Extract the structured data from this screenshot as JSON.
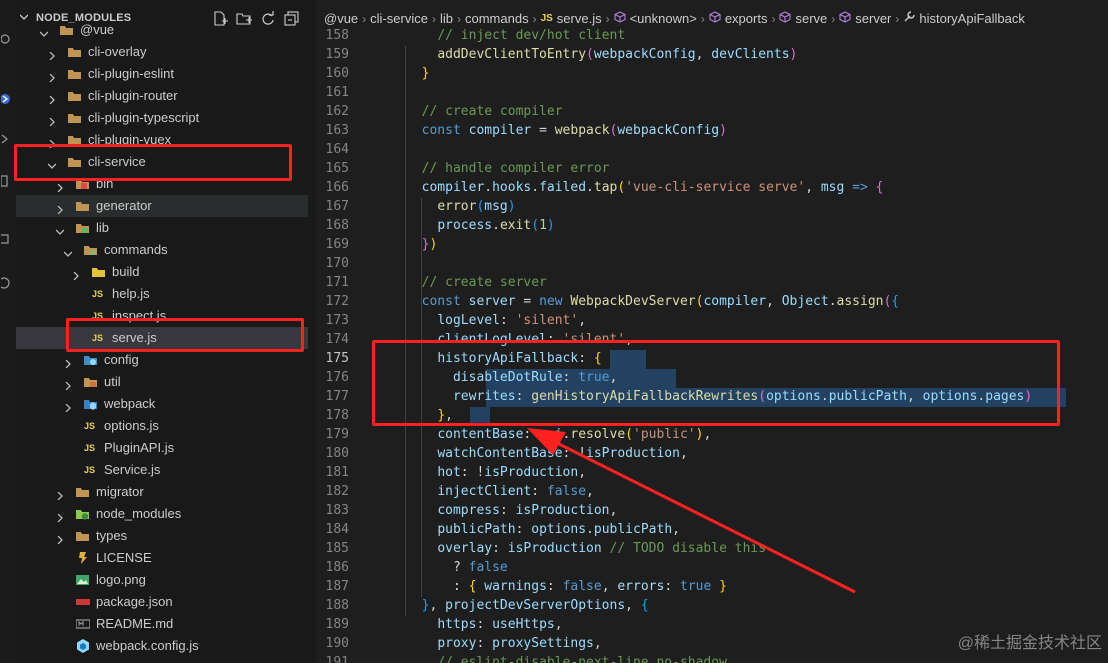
{
  "explorer": {
    "header": "NODE_MODULES",
    "actions": [
      "new-file-icon",
      "new-folder-icon",
      "refresh-icon",
      "collapse-all-icon"
    ],
    "items": [
      {
        "label": "@vue",
        "depth": 0,
        "type": "folder",
        "expanded": true
      },
      {
        "label": "cli-overlay",
        "depth": 1,
        "type": "folder"
      },
      {
        "label": "cli-plugin-eslint",
        "depth": 1,
        "type": "folder"
      },
      {
        "label": "cli-plugin-router",
        "depth": 1,
        "type": "folder"
      },
      {
        "label": "cli-plugin-typescript",
        "depth": 1,
        "type": "folder"
      },
      {
        "label": "cli-plugin-vuex",
        "depth": 1,
        "type": "folder"
      },
      {
        "label": "cli-service",
        "depth": 1,
        "type": "folder",
        "expanded": true
      },
      {
        "label": "bin",
        "depth": 2,
        "type": "folder-bin"
      },
      {
        "label": "generator",
        "depth": 2,
        "type": "folder"
      },
      {
        "label": "lib",
        "depth": 2,
        "type": "folder-lib",
        "expanded": true
      },
      {
        "label": "commands",
        "depth": 3,
        "type": "folder-cmd",
        "expanded": true
      },
      {
        "label": "build",
        "depth": 4,
        "type": "folder-yellow"
      },
      {
        "label": "help.js",
        "depth": 4,
        "type": "js"
      },
      {
        "label": "inspect.js",
        "depth": 4,
        "type": "js"
      },
      {
        "label": "serve.js",
        "depth": 4,
        "type": "js",
        "active": true
      },
      {
        "label": "config",
        "depth": 3,
        "type": "folder-config"
      },
      {
        "label": "util",
        "depth": 3,
        "type": "folder-util"
      },
      {
        "label": "webpack",
        "depth": 3,
        "type": "folder-webpack"
      },
      {
        "label": "options.js",
        "depth": 3,
        "type": "js"
      },
      {
        "label": "PluginAPI.js",
        "depth": 3,
        "type": "js"
      },
      {
        "label": "Service.js",
        "depth": 3,
        "type": "js"
      },
      {
        "label": "migrator",
        "depth": 2,
        "type": "folder"
      },
      {
        "label": "node_modules",
        "depth": 2,
        "type": "folder-node"
      },
      {
        "label": "types",
        "depth": 2,
        "type": "folder"
      },
      {
        "label": "LICENSE",
        "depth": 2,
        "type": "license"
      },
      {
        "label": "logo.png",
        "depth": 2,
        "type": "image"
      },
      {
        "label": "package.json",
        "depth": 2,
        "type": "npm"
      },
      {
        "label": "README.md",
        "depth": 2,
        "type": "readme"
      },
      {
        "label": "webpack.config.js",
        "depth": 2,
        "type": "webpack-config"
      }
    ]
  },
  "breadcrumb": [
    "@vue",
    "cli-service",
    "lib",
    "commands",
    "serve.js",
    "<unknown>",
    "exports",
    "serve",
    "server",
    "historyApiFallback"
  ],
  "breadcrumb_icons": {
    "serve.js": "JS",
    "<unknown>": "cube-icon",
    "exports": "cube-icon",
    "serve": "cube-icon",
    "server": "cube-icon",
    "historyApiFallback": "wrench-icon"
  },
  "editor": {
    "current_line": "175",
    "lines": [
      {
        "n": "158",
        "t": [
          [
            "    ",
            "p"
          ],
          [
            "// inject dev/hot client",
            "c"
          ]
        ]
      },
      {
        "n": "159",
        "t": [
          [
            "    ",
            "p"
          ],
          [
            "addDevClientToEntry",
            "f"
          ],
          [
            "(",
            "b2"
          ],
          [
            "webpackConfig",
            "v"
          ],
          [
            ", ",
            "p"
          ],
          [
            "devClients",
            "v"
          ],
          [
            ")",
            "b2"
          ]
        ]
      },
      {
        "n": "160",
        "t": [
          [
            "  ",
            "p"
          ],
          [
            "}",
            "b1"
          ]
        ]
      },
      {
        "n": "161",
        "t": [
          [
            "",
            "p"
          ]
        ]
      },
      {
        "n": "162",
        "t": [
          [
            "  ",
            "p"
          ],
          [
            "// create compiler",
            "c"
          ]
        ]
      },
      {
        "n": "163",
        "t": [
          [
            "  ",
            "p"
          ],
          [
            "const ",
            "k"
          ],
          [
            "compiler",
            "v"
          ],
          [
            " = ",
            "p"
          ],
          [
            "webpack",
            "f"
          ],
          [
            "(",
            "b2"
          ],
          [
            "webpackConfig",
            "v"
          ],
          [
            ")",
            "b2"
          ]
        ]
      },
      {
        "n": "164",
        "t": [
          [
            "",
            "p"
          ]
        ]
      },
      {
        "n": "165",
        "t": [
          [
            "  ",
            "p"
          ],
          [
            "// handle compiler error",
            "c"
          ]
        ]
      },
      {
        "n": "166",
        "t": [
          [
            "  ",
            "p"
          ],
          [
            "compiler",
            "v"
          ],
          [
            ".",
            "p"
          ],
          [
            "hooks",
            "v"
          ],
          [
            ".",
            "p"
          ],
          [
            "failed",
            "v"
          ],
          [
            ".",
            "p"
          ],
          [
            "tap",
            "f"
          ],
          [
            "(",
            "b1"
          ],
          [
            "'vue-cli-service serve'",
            "s"
          ],
          [
            ", ",
            "p"
          ],
          [
            "msg",
            "v"
          ],
          [
            " ",
            "p"
          ],
          [
            "=>",
            "k"
          ],
          [
            " ",
            "p"
          ],
          [
            "{",
            "b2"
          ]
        ]
      },
      {
        "n": "167",
        "t": [
          [
            "    ",
            "p"
          ],
          [
            "error",
            "f"
          ],
          [
            "(",
            "b3"
          ],
          [
            "msg",
            "v"
          ],
          [
            ")",
            "b3"
          ]
        ]
      },
      {
        "n": "168",
        "t": [
          [
            "    ",
            "p"
          ],
          [
            "process",
            "v"
          ],
          [
            ".",
            "p"
          ],
          [
            "exit",
            "f"
          ],
          [
            "(",
            "b3"
          ],
          [
            "1",
            "n"
          ],
          [
            ")",
            "b3"
          ]
        ]
      },
      {
        "n": "169",
        "t": [
          [
            "  ",
            "p"
          ],
          [
            "}",
            "b2"
          ],
          [
            ")",
            "b1"
          ]
        ]
      },
      {
        "n": "170",
        "t": [
          [
            "",
            "p"
          ]
        ]
      },
      {
        "n": "171",
        "t": [
          [
            "  ",
            "p"
          ],
          [
            "// create server",
            "c"
          ]
        ]
      },
      {
        "n": "172",
        "t": [
          [
            "  ",
            "p"
          ],
          [
            "const ",
            "k"
          ],
          [
            "server",
            "v"
          ],
          [
            " = ",
            "p"
          ],
          [
            "new ",
            "k"
          ],
          [
            "WebpackDevServer",
            "f"
          ],
          [
            "(",
            "b1"
          ],
          [
            "compiler",
            "v"
          ],
          [
            ", ",
            "p"
          ],
          [
            "Object",
            "v"
          ],
          [
            ".",
            "p"
          ],
          [
            "assign",
            "f"
          ],
          [
            "(",
            "b2"
          ],
          [
            "{",
            "b3"
          ]
        ]
      },
      {
        "n": "173",
        "t": [
          [
            "    ",
            "p"
          ],
          [
            "logLevel",
            "v"
          ],
          [
            ": ",
            "p"
          ],
          [
            "'silent'",
            "s"
          ],
          [
            ",",
            "p"
          ]
        ]
      },
      {
        "n": "174",
        "t": [
          [
            "    ",
            "p"
          ],
          [
            "clientLogLevel",
            "v"
          ],
          [
            ": ",
            "p"
          ],
          [
            "'silent'",
            "s"
          ],
          [
            ",",
            "p"
          ]
        ]
      },
      {
        "n": "175",
        "t": [
          [
            "    ",
            "p"
          ],
          [
            "historyApiFallback",
            "v"
          ],
          [
            ": ",
            "p"
          ],
          [
            "{",
            "b1"
          ]
        ]
      },
      {
        "n": "176",
        "t": [
          [
            "      ",
            "p"
          ],
          [
            "disableDotRule",
            "v"
          ],
          [
            ": ",
            "p"
          ],
          [
            "true",
            "k"
          ],
          [
            ",",
            "p"
          ]
        ]
      },
      {
        "n": "177",
        "t": [
          [
            "      ",
            "p"
          ],
          [
            "rewrites",
            "v"
          ],
          [
            ": ",
            "p"
          ],
          [
            "genHistoryApiFallbackRewrites",
            "f"
          ],
          [
            "(",
            "b2"
          ],
          [
            "options",
            "v"
          ],
          [
            ".",
            "p"
          ],
          [
            "publicPath",
            "v"
          ],
          [
            ", ",
            "p"
          ],
          [
            "options",
            "v"
          ],
          [
            ".",
            "p"
          ],
          [
            "pages",
            "v"
          ],
          [
            ")",
            "b2"
          ]
        ]
      },
      {
        "n": "178",
        "t": [
          [
            "    ",
            "p"
          ],
          [
            "}",
            "b1"
          ],
          [
            ",",
            "p"
          ]
        ]
      },
      {
        "n": "179",
        "t": [
          [
            "    ",
            "p"
          ],
          [
            "contentBase",
            "v"
          ],
          [
            ": ",
            "p"
          ],
          [
            "api",
            "v"
          ],
          [
            ".",
            "p"
          ],
          [
            "resolve",
            "f"
          ],
          [
            "(",
            "b1"
          ],
          [
            "'public'",
            "s"
          ],
          [
            ")",
            "b1"
          ],
          [
            ",",
            "p"
          ]
        ]
      },
      {
        "n": "180",
        "t": [
          [
            "    ",
            "p"
          ],
          [
            "watchContentBase",
            "v"
          ],
          [
            ": ",
            "p"
          ],
          [
            "!",
            "p"
          ],
          [
            "isProduction",
            "v"
          ],
          [
            ",",
            "p"
          ]
        ]
      },
      {
        "n": "181",
        "t": [
          [
            "    ",
            "p"
          ],
          [
            "hot",
            "v"
          ],
          [
            ": ",
            "p"
          ],
          [
            "!",
            "p"
          ],
          [
            "isProduction",
            "v"
          ],
          [
            ",",
            "p"
          ]
        ]
      },
      {
        "n": "182",
        "t": [
          [
            "    ",
            "p"
          ],
          [
            "injectClient",
            "v"
          ],
          [
            ": ",
            "p"
          ],
          [
            "false",
            "k"
          ],
          [
            ",",
            "p"
          ]
        ]
      },
      {
        "n": "183",
        "t": [
          [
            "    ",
            "p"
          ],
          [
            "compress",
            "v"
          ],
          [
            ": ",
            "p"
          ],
          [
            "isProduction",
            "v"
          ],
          [
            ",",
            "p"
          ]
        ]
      },
      {
        "n": "184",
        "t": [
          [
            "    ",
            "p"
          ],
          [
            "publicPath",
            "v"
          ],
          [
            ": ",
            "p"
          ],
          [
            "options",
            "v"
          ],
          [
            ".",
            "p"
          ],
          [
            "publicPath",
            "v"
          ],
          [
            ",",
            "p"
          ]
        ]
      },
      {
        "n": "185",
        "t": [
          [
            "    ",
            "p"
          ],
          [
            "overlay",
            "v"
          ],
          [
            ": ",
            "p"
          ],
          [
            "isProduction",
            "v"
          ],
          [
            " ",
            "p"
          ],
          [
            "// TODO disable this",
            "c"
          ]
        ]
      },
      {
        "n": "186",
        "t": [
          [
            "      ",
            "p"
          ],
          [
            "? ",
            "p"
          ],
          [
            "false",
            "k"
          ]
        ]
      },
      {
        "n": "187",
        "t": [
          [
            "      ",
            "p"
          ],
          [
            ": ",
            "p"
          ],
          [
            "{",
            "b1"
          ],
          [
            " ",
            "p"
          ],
          [
            "warnings",
            "v"
          ],
          [
            ": ",
            "p"
          ],
          [
            "false",
            "k"
          ],
          [
            ", ",
            "p"
          ],
          [
            "errors",
            "v"
          ],
          [
            ": ",
            "p"
          ],
          [
            "true",
            "k"
          ],
          [
            " ",
            "p"
          ],
          [
            "}",
            "b1"
          ]
        ]
      },
      {
        "n": "188",
        "t": [
          [
            "  ",
            "p"
          ],
          [
            "}",
            "b3"
          ],
          [
            ", ",
            "p"
          ],
          [
            "projectDevServerOptions",
            "v"
          ],
          [
            ", ",
            "p"
          ],
          [
            "{",
            "b3"
          ]
        ]
      },
      {
        "n": "189",
        "t": [
          [
            "    ",
            "p"
          ],
          [
            "https",
            "v"
          ],
          [
            ": ",
            "p"
          ],
          [
            "useHttps",
            "v"
          ],
          [
            ",",
            "p"
          ]
        ]
      },
      {
        "n": "190",
        "t": [
          [
            "    ",
            "p"
          ],
          [
            "proxy",
            "v"
          ],
          [
            ": ",
            "p"
          ],
          [
            "proxySettings",
            "v"
          ],
          [
            ",",
            "p"
          ]
        ]
      },
      {
        "n": "191",
        "t": [
          [
            "    ",
            "p"
          ],
          [
            "// eslint-disable-next-line no-shadow",
            "c"
          ]
        ]
      }
    ]
  },
  "watermark": "@稀土掘金技术社区",
  "colors": {
    "annotation": "#ff2020",
    "selection": "#264f78",
    "js_icon": "#e8d44d",
    "folder": "#c09553"
  }
}
